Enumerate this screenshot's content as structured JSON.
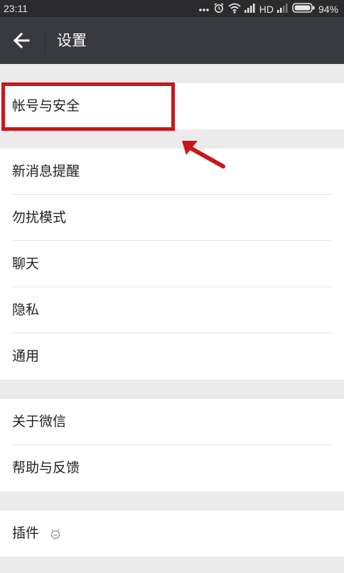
{
  "status_bar": {
    "time": "23:11",
    "network_label": "HD",
    "battery_percent": "94%"
  },
  "header": {
    "title": "设置"
  },
  "groups": [
    {
      "items": [
        {
          "label": "帐号与安全"
        }
      ]
    },
    {
      "items": [
        {
          "label": "新消息提醒"
        },
        {
          "label": "勿扰模式"
        },
        {
          "label": "聊天"
        },
        {
          "label": "隐私"
        },
        {
          "label": "通用"
        }
      ]
    },
    {
      "items": [
        {
          "label": "关于微信"
        },
        {
          "label": "帮助与反馈"
        }
      ]
    },
    {
      "items": [
        {
          "label": "插件",
          "icon": "plugin-icon"
        }
      ]
    }
  ],
  "colors": {
    "titlebar": "#393a3f",
    "statusbar": "#2b2b2d",
    "page_background": "#ebebeb",
    "annotation": "#c9161c"
  }
}
